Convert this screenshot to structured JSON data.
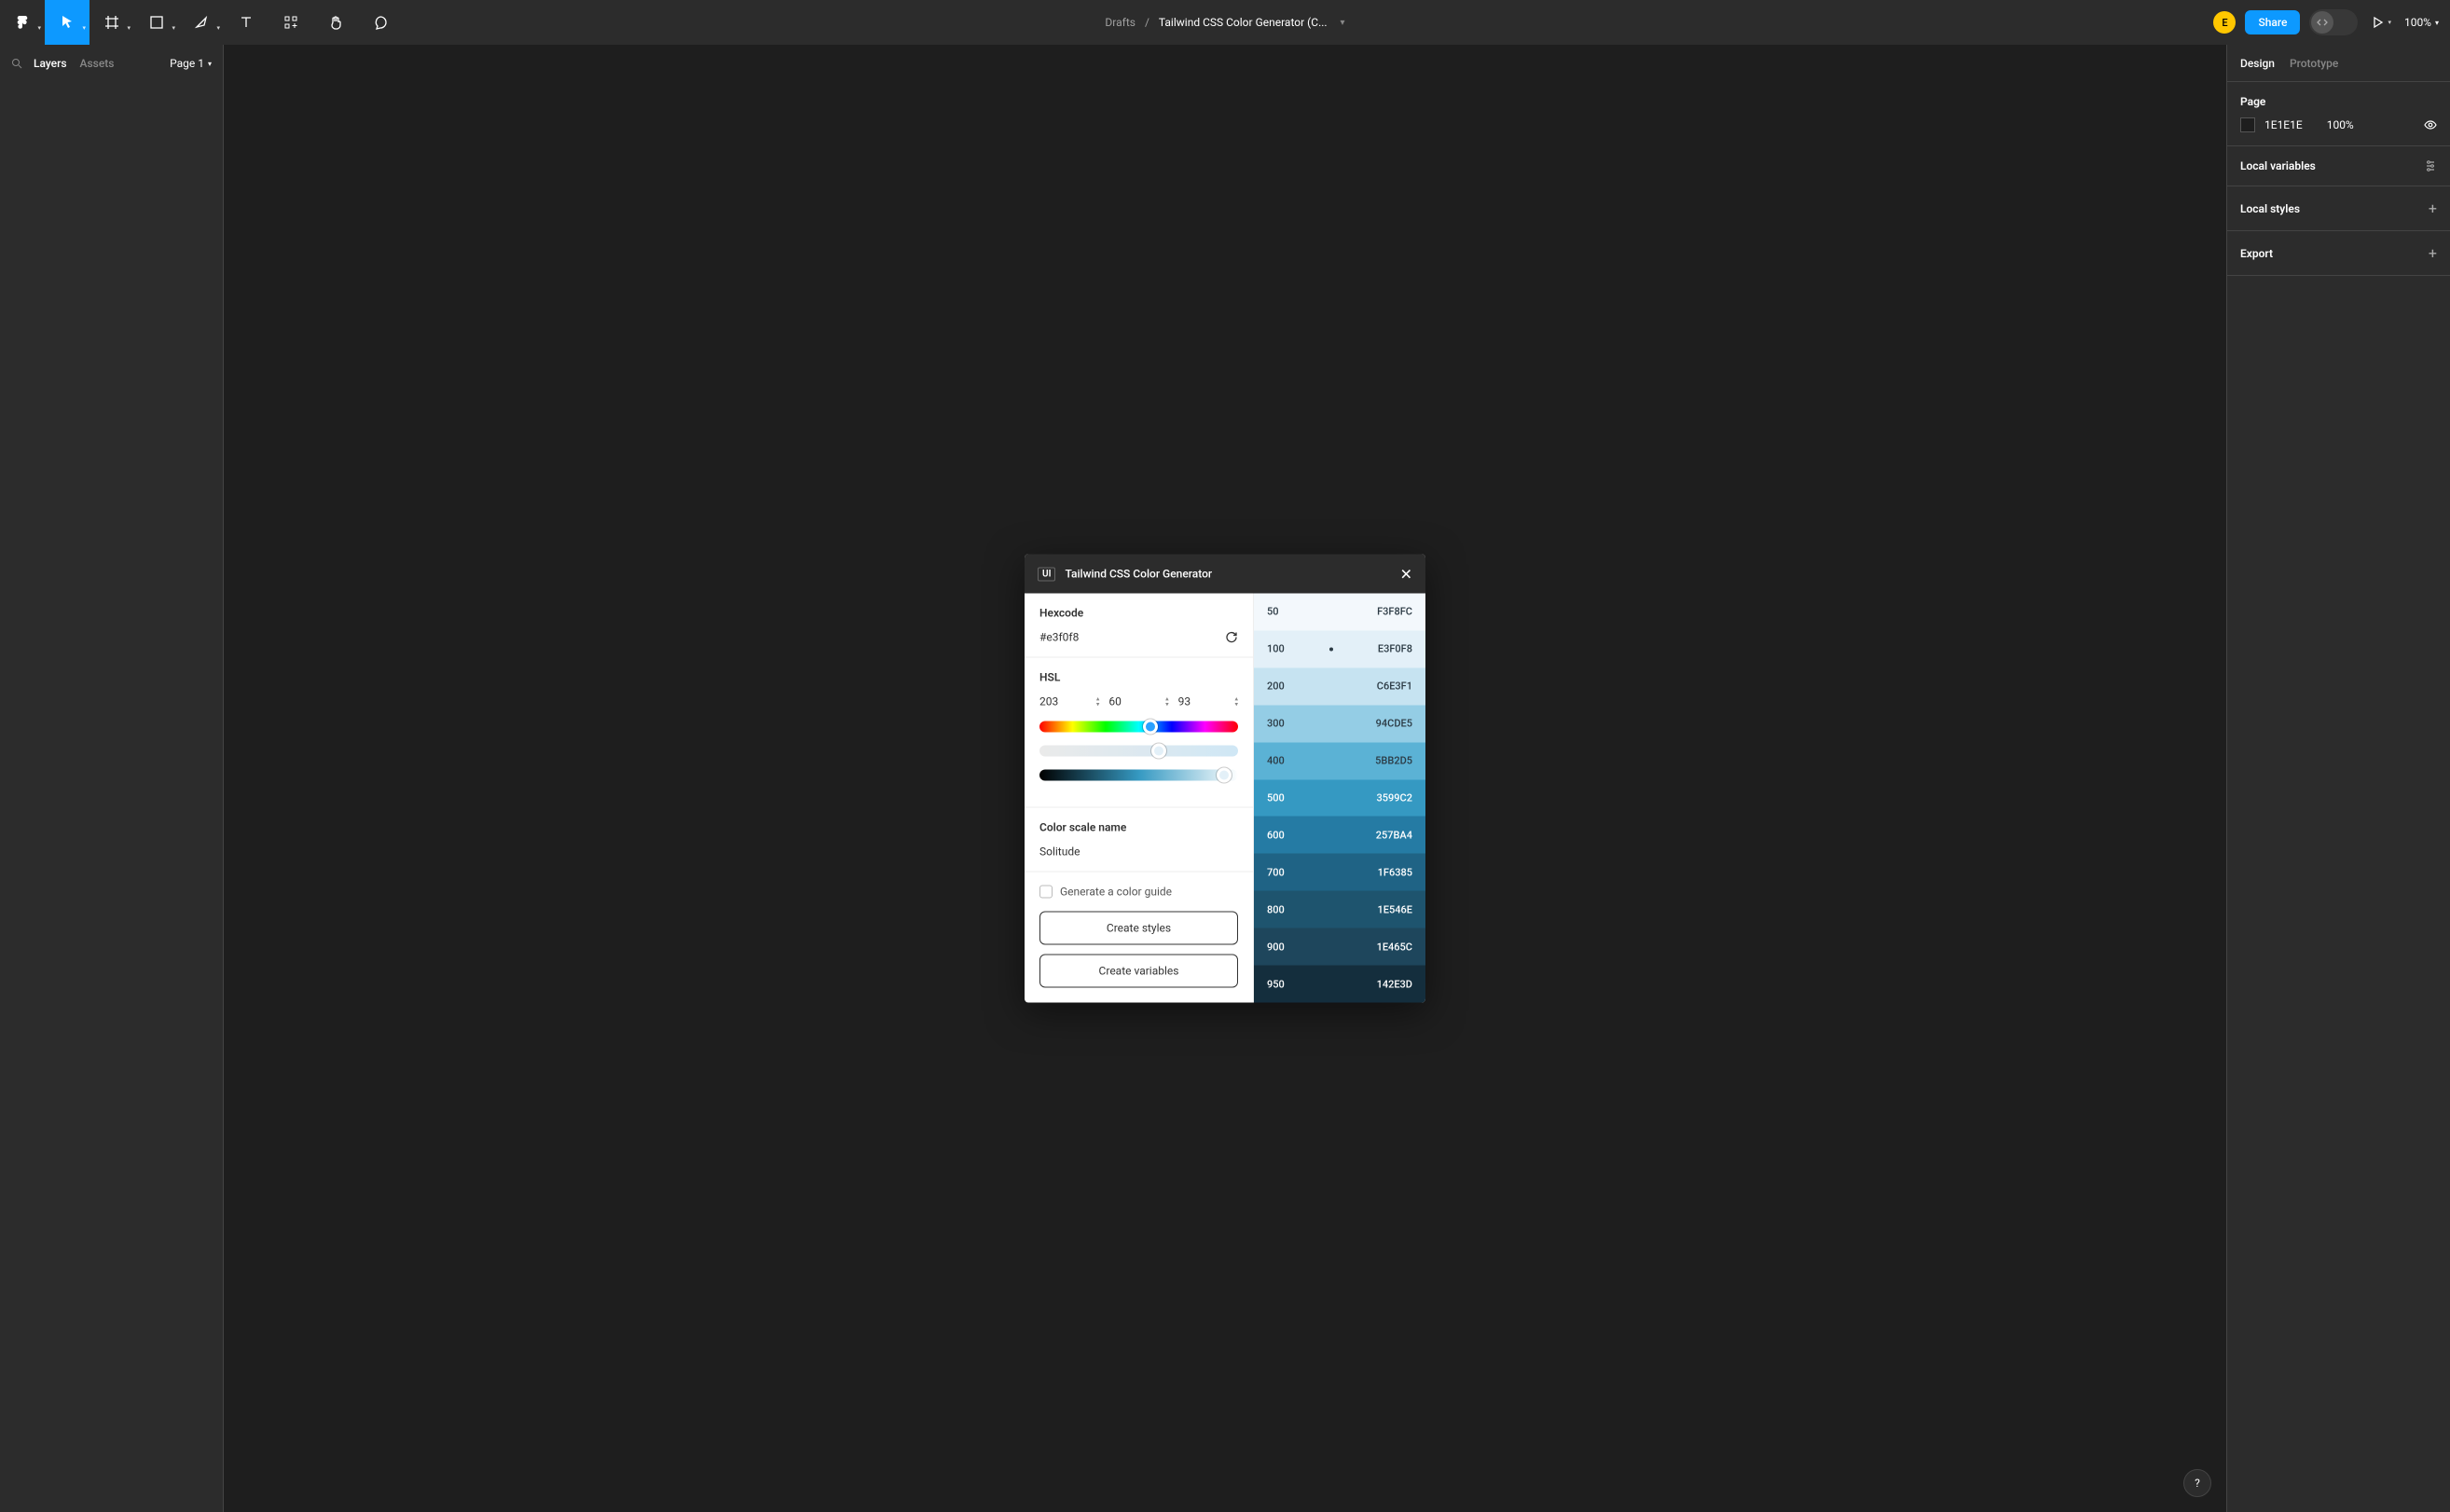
{
  "toolbar": {
    "breadcrumb_parent": "Drafts",
    "breadcrumb_title": "Tailwind CSS Color Generator (C...",
    "share_label": "Share",
    "zoom_label": "100%",
    "avatar_initial": "E"
  },
  "left_panel": {
    "tab_layers": "Layers",
    "tab_assets": "Assets",
    "page_selector": "Page 1"
  },
  "right_panel": {
    "tab_design": "Design",
    "tab_prototype": "Prototype",
    "section_page": "Page",
    "page_color_hex": "1E1E1E",
    "page_color_opacity": "100%",
    "section_local_variables": "Local variables",
    "section_local_styles": "Local styles",
    "section_export": "Export"
  },
  "plugin": {
    "badge": "UI",
    "title": "Tailwind CSS Color Generator",
    "hex_label": "Hexcode",
    "hex_value": "#e3f0f8",
    "hsl_label": "HSL",
    "hsl_h": "203",
    "hsl_s": "60",
    "hsl_l": "93",
    "scale_name_label": "Color scale name",
    "scale_name_value": "Solitude",
    "guide_label": "Generate a color guide",
    "create_styles_label": "Create styles",
    "create_variables_label": "Create variables",
    "scale": [
      {
        "step": "50",
        "hex": "F3F8FC",
        "bg": "#F3F8FC",
        "dark": false,
        "active": false
      },
      {
        "step": "100",
        "hex": "E3F0F8",
        "bg": "#E3F0F8",
        "dark": false,
        "active": true
      },
      {
        "step": "200",
        "hex": "C6E3F1",
        "bg": "#C6E3F1",
        "dark": false,
        "active": false
      },
      {
        "step": "300",
        "hex": "94CDE5",
        "bg": "#94CDE5",
        "dark": false,
        "active": false
      },
      {
        "step": "400",
        "hex": "5BB2D5",
        "bg": "#5BB2D5",
        "dark": false,
        "active": false
      },
      {
        "step": "500",
        "hex": "3599C2",
        "bg": "#3599C2",
        "dark": true,
        "active": false
      },
      {
        "step": "600",
        "hex": "257BA4",
        "bg": "#257BA4",
        "dark": true,
        "active": false
      },
      {
        "step": "700",
        "hex": "1F6385",
        "bg": "#1F6385",
        "dark": true,
        "active": false
      },
      {
        "step": "800",
        "hex": "1E546E",
        "bg": "#1E546E",
        "dark": true,
        "active": false
      },
      {
        "step": "900",
        "hex": "1E465C",
        "bg": "#1E465C",
        "dark": true,
        "active": false
      },
      {
        "step": "950",
        "hex": "142E3D",
        "bg": "#142E3D",
        "dark": true,
        "active": false
      }
    ]
  }
}
